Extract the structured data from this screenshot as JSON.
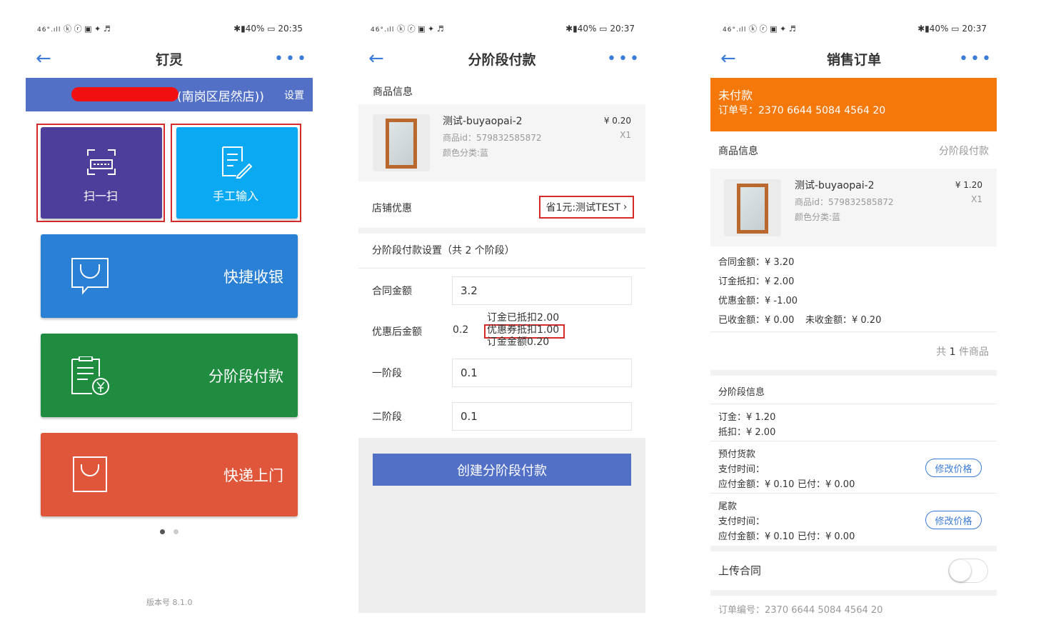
{
  "phone1": {
    "status": {
      "signal": "46°.ıll",
      "icons": "ⓚ ⓡ ▣ ✦ ♬",
      "battery": "40%",
      "time": "20:35"
    },
    "nav": {
      "title": "钉灵"
    },
    "banner": {
      "store": "(南岗区居然店))",
      "settings": "设置"
    },
    "tiles": {
      "scan": "扫一扫",
      "manual": "手工输入",
      "quick_cashier": "快捷收银",
      "stage_payment": "分阶段付款",
      "delivery": "快递上门"
    },
    "version": "版本号 8.1.0",
    "colors": {
      "banner": "#5370c7",
      "scan": "#4e3e9c",
      "manual": "#0aa9f2",
      "quick": "#2980d5",
      "stage": "#1f8c40",
      "delivery": "#e0563a"
    }
  },
  "phone2": {
    "status": {
      "signal": "46°.ıll",
      "icons": "ⓚ ⓡ ▣ ✦ ♬",
      "battery": "40%",
      "time": "20:37"
    },
    "nav": {
      "title": "分阶段付款"
    },
    "product_section": "商品信息",
    "product": {
      "name": "测试-buyaopai-2",
      "id": "商品id：579832585872",
      "color": "颜色分类:蓝",
      "price": "¥ 0.20",
      "qty": "X1"
    },
    "store_discount_label": "店铺优惠",
    "store_discount_value": "省1元:测试TEST",
    "settings_title": "分阶段付款设置（共 2 个阶段）",
    "contract_label": "合同金额",
    "contract_value": "3.2",
    "after_discount_label": "优惠后金额",
    "after_discount_value": "0.2",
    "notes": {
      "deposit_deducted": "订金已抵扣2.00",
      "coupon": "优惠券抵扣1.00",
      "deposit": "订金金额0.20"
    },
    "stage1_label": "一阶段",
    "stage1_value": "0.1",
    "stage2_label": "二阶段",
    "stage2_value": "0.1",
    "create_button": "创建分阶段付款"
  },
  "phone3": {
    "status": {
      "signal": "46°.ıll",
      "icons": "ⓚ ⓡ ▣ ✦ ♬",
      "battery": "40%",
      "time": "20:37"
    },
    "nav": {
      "title": "销售订单"
    },
    "header": {
      "status": "未付款",
      "order_no": "订单号：2370 6644 5084 4564 20"
    },
    "product_section": "商品信息",
    "product_type": "分阶段付款",
    "product": {
      "name": "测试-buyaopai-2",
      "id": "商品id：579832585872",
      "color": "颜色分类:蓝",
      "price": "¥ 1.20",
      "qty": "X1"
    },
    "amounts": {
      "contract": "合同金额：¥ 3.20",
      "deposit_deduct": "订金抵扣：¥ 2.00",
      "discount": "优惠金额：¥ -1.00",
      "received": "已收金额：¥ 0.00",
      "unreceived": "未收金额：¥ 0.20"
    },
    "total_prefix": "共",
    "total_count": "1",
    "total_suffix": "件商品",
    "stage_info_title": "分阶段信息",
    "deposit_line1": "订金：¥ 1.20",
    "deposit_line2": "抵扣：¥ 2.00",
    "prepay": {
      "title": "预付货款",
      "time": "支付时间：",
      "amount": "应付金额：¥ 0.10",
      "paid": "已付：¥ 0.00",
      "button": "修改价格"
    },
    "final": {
      "title": "尾款",
      "time": "支付时间：",
      "amount": "应付金额：¥ 0.10",
      "paid": "已付：¥ 0.00",
      "button": "修改价格"
    },
    "upload_contract": "上传合同",
    "footer_order_no": "订单编号：2370 6644 5084 4564 20",
    "colors": {
      "header": "#f5780a"
    }
  }
}
